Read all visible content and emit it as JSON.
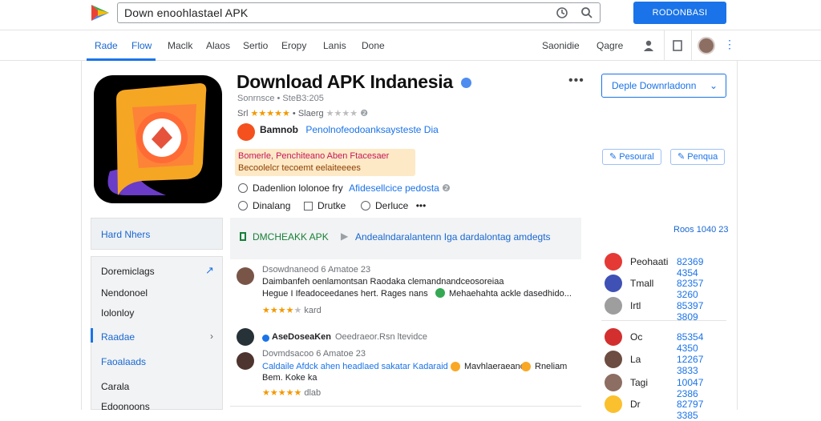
{
  "search": {
    "query": "Down enoohlastael APK"
  },
  "header": {
    "cta_label": "RODONBASI"
  },
  "nav": {
    "items": [
      "Rade",
      "Flow",
      "Maclk",
      "Alaos",
      "Sertio",
      "Eropy",
      "Lanis",
      "Done"
    ],
    "right": [
      "Saonidie",
      "Qagre"
    ]
  },
  "app": {
    "title": "Download APK Indanesia",
    "subtitle": "Sonrnsce • SteB3:205",
    "rating_prefix": "Srl",
    "rating_suffix": "Slaerg",
    "developer_name": "Bamnob",
    "developer_link": "Penolnofeodoanksaysteste Dia",
    "promo_line1": "Bomerle, Penchiteano Aben Ftacesaer",
    "promo_line2": "Becoolelcr tecoemt eelaiteeees",
    "option1_label": "Dadenlion lolonoe fry",
    "option1_link": "Afidesellcice pedosta",
    "option2": "Dinalang",
    "option3": "Drutke",
    "option4": "Derluce",
    "select_label": "Deple Downrladonn",
    "btn1": "Pesoural",
    "btn2": "Penqua"
  },
  "left": {
    "panel_title": "Hard Nhers",
    "menu": [
      "Doremiclags",
      "Nendonoel",
      "Iolonloy",
      "Raadae",
      "Faoalaads",
      "Carala",
      "Edoonoons"
    ]
  },
  "main": {
    "panel_green": "DMCHEAKK APK",
    "panel_text": "Andealndaralantenn Iga dardalontag amdegts"
  },
  "reviews": [
    {
      "head": "Dsowdnaneod 6 Amatoe 23",
      "line1": "Daimbanfeh oenlamontsan Raodaka clemandnandceosoreiaa",
      "line2": "Hegue I Ifeadoceedanes hert. Rages nans",
      "line3": "Mehaehahta ackle dasedhido...",
      "meta": "kard"
    },
    {
      "head": "AseDoseaKen",
      "head2": "Oeedraeor.Rsn ltevidce",
      "sub": "Dovmdsacoo 6 Amatoe 23",
      "line1": "Caldaile Afdck ahen headlaed sakatar Kadaraid",
      "line1b": "Mavhlaeraeand",
      "line1c": "Rneliam",
      "line2": "Bem.    Koke ka",
      "meta": "dlab"
    }
  ],
  "right": {
    "header": "Roos 1040 23",
    "rows": [
      {
        "name": "Peohaati",
        "value": "82369 4354",
        "color": "#e53935"
      },
      {
        "name": "Tmall",
        "value": "82357 3260",
        "color": "#3f51b5"
      },
      {
        "name": "Irtl",
        "value": "85397 3809",
        "color": "#9e9e9e"
      },
      {
        "name": "Oc",
        "value": "85354 4350",
        "color": "#d32f2f"
      },
      {
        "name": "La",
        "value": "12267 3833",
        "color": "#6d4c41"
      },
      {
        "name": "Tagi",
        "value": "10047 2386",
        "color": "#8d6e63"
      },
      {
        "name": "Dr",
        "value": "82797 3385",
        "color": "#fbc02d"
      }
    ]
  }
}
